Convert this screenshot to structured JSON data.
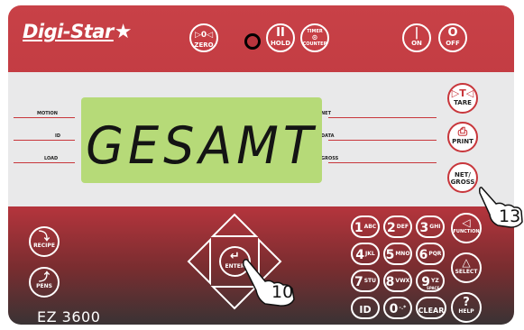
{
  "brand": {
    "logo_text": "Digi-Star",
    "star_icon": "star-icon",
    "model": "EZ 3600"
  },
  "top_buttons": {
    "zero": {
      "symbol": "▷0◁",
      "label": "ZERO"
    },
    "hold": {
      "symbol": "II",
      "label": "HOLD"
    },
    "timer": {
      "symbol": "TIMER",
      "label": "COUNTER"
    },
    "on": {
      "symbol": "|",
      "label": "ON"
    },
    "off": {
      "symbol": "O",
      "label": "OFF"
    }
  },
  "indicators": {
    "left": [
      "MOTION",
      "ID",
      "LOAD"
    ],
    "right": [
      "NET",
      "DATA",
      "GROSS"
    ]
  },
  "display": {
    "text": "GESAMT"
  },
  "display_buttons": {
    "tare": {
      "symbol": "▷T◁",
      "label": "TARE"
    },
    "print": {
      "symbol": "⎙",
      "label": "PRINT"
    },
    "net_gross": {
      "label1": "NET/",
      "label2": "GROSS"
    }
  },
  "left_buttons": {
    "recipe": {
      "symbol": "⤵",
      "label": "RECIPE"
    },
    "pens": {
      "symbol": "⤴",
      "label": "PENS"
    }
  },
  "nav": {
    "enter_label": "ENTER"
  },
  "keypad": [
    {
      "d": "1",
      "s": "ABC"
    },
    {
      "d": "2",
      "s": "DEF"
    },
    {
      "d": "3",
      "s": "GHI"
    },
    {
      "d": "4",
      "s": "JKL"
    },
    {
      "d": "5",
      "s": "MNO"
    },
    {
      "d": "6",
      "s": "PQR"
    },
    {
      "d": "7",
      "s": "STU"
    },
    {
      "d": "8",
      "s": "VWX"
    },
    {
      "d": "9",
      "s": "YZ"
    },
    {
      "d": "ID",
      "s": ""
    },
    {
      "d": "0",
      "s": "-.*"
    },
    {
      "d": "CLEAR",
      "s": ""
    }
  ],
  "key9_sub2": "SPACE",
  "right_buttons": {
    "function": {
      "symbol": "◁",
      "label": "FUNCTION"
    },
    "select": {
      "symbol": "△",
      "label": "SELECT"
    },
    "help": {
      "symbol": "?",
      "label": "HELP"
    }
  },
  "callouts": {
    "enter": "10",
    "net_gross": "13"
  }
}
